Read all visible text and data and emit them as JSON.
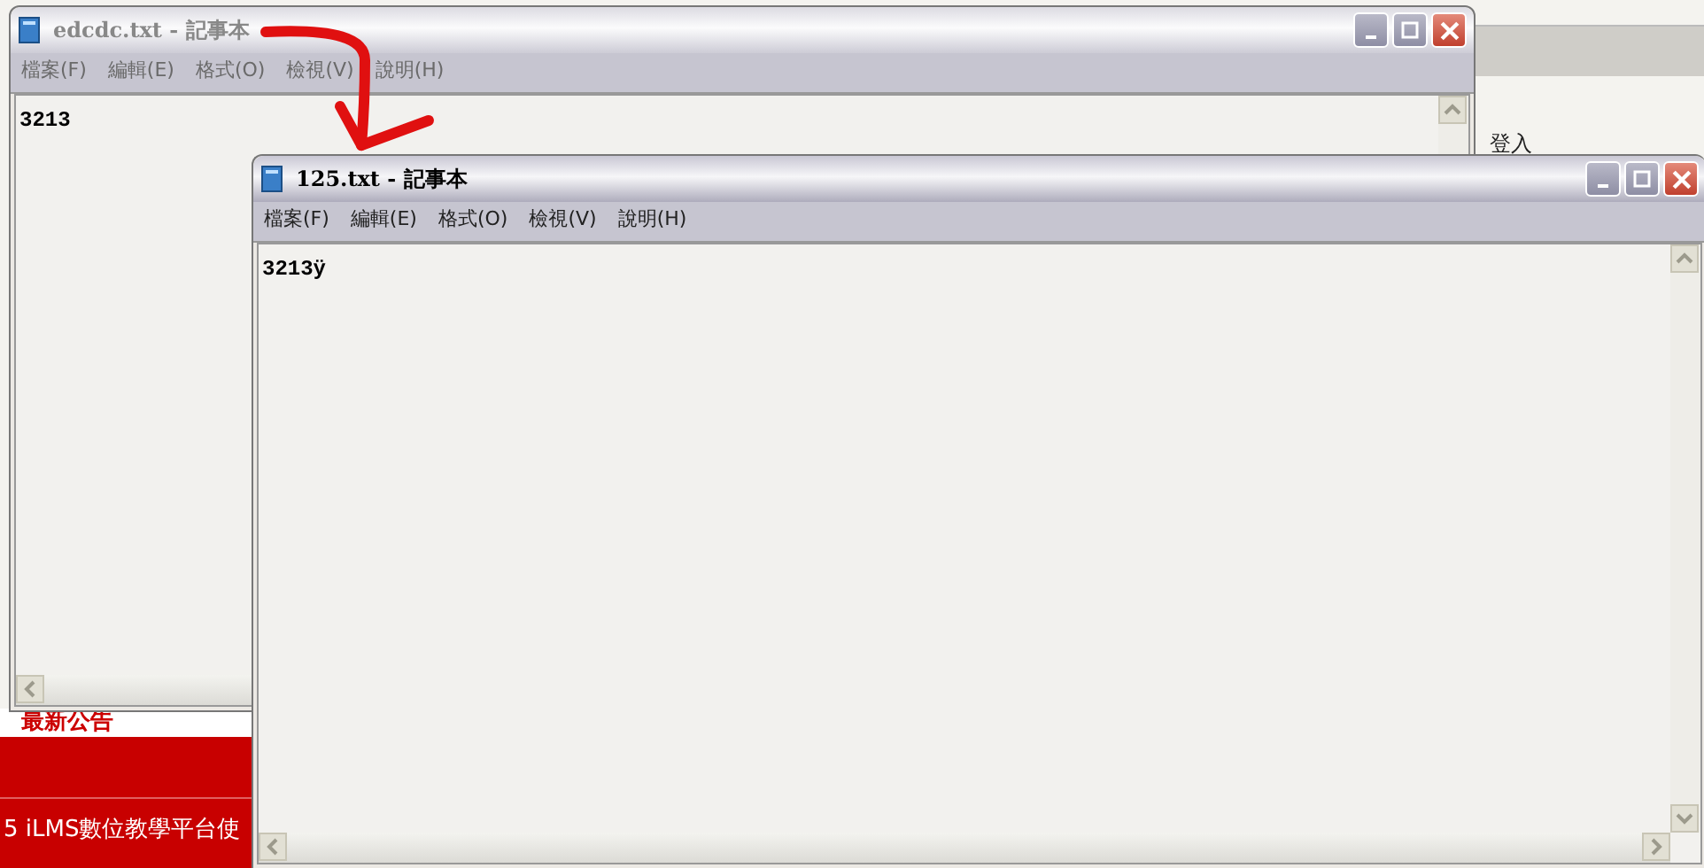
{
  "background_page": {
    "login_link": "登入",
    "announcements_title": "最新公告",
    "announcement": "5 iLMS數位教學平台使"
  },
  "windows": [
    {
      "title": "edcdc.txt - 記事本",
      "active": false,
      "menu": [
        "檔案(F)",
        "編輯(E)",
        "格式(O)",
        "檢視(V)",
        "說明(H)"
      ],
      "content": "3213"
    },
    {
      "title": "125.txt - 記事本",
      "active": true,
      "menu": [
        "檔案(F)",
        "編輯(E)",
        "格式(O)",
        "檢視(V)",
        "說明(H)"
      ],
      "content": "3213ÿ"
    }
  ]
}
